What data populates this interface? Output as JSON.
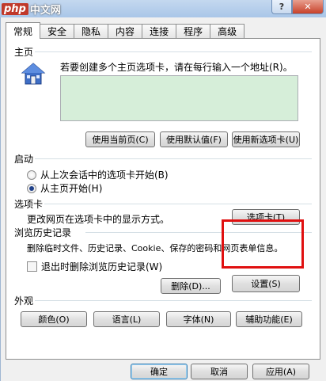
{
  "watermark": {
    "php": "php",
    "cn": "中文网"
  },
  "titlebar": {
    "help": "?",
    "close": "✕"
  },
  "tabs": [
    "常规",
    "安全",
    "隐私",
    "内容",
    "连接",
    "程序",
    "高级"
  ],
  "home": {
    "title": "主页",
    "description": "若要创建多个主页选项卡，请在每行输入一个地址(R)。",
    "use_current": "使用当前页(C)",
    "use_default": "使用默认值(F)",
    "use_new_tab": "使用新选项卡(U)"
  },
  "startup": {
    "title": "启动",
    "option_last_session": "从上次会话中的选项卡开始(B)",
    "option_home": "从主页开始(H)",
    "selected": "option_home"
  },
  "tabs_section": {
    "title": "选项卡",
    "description": "更改网页在选项卡中的显示方式。",
    "button": "选项卡(T)"
  },
  "history": {
    "title": "浏览历史记录",
    "description": "删除临时文件、历史记录、Cookie、保存的密码和网页表单信息。",
    "delete_on_exit": "退出时删除浏览历史记录(W)",
    "delete_on_exit_checked": false,
    "delete_button": "删除(D)...",
    "settings_button": "设置(S)"
  },
  "appearance": {
    "title": "外观",
    "colors": "颜色(O)",
    "languages": "语言(L)",
    "fonts": "字体(N)",
    "accessibility": "辅助功能(E)"
  },
  "footer": {
    "ok": "确定",
    "cancel": "取消",
    "apply": "应用(A)"
  },
  "colors": {
    "highlight": "#e01010",
    "home_field": "#d6eed9"
  }
}
